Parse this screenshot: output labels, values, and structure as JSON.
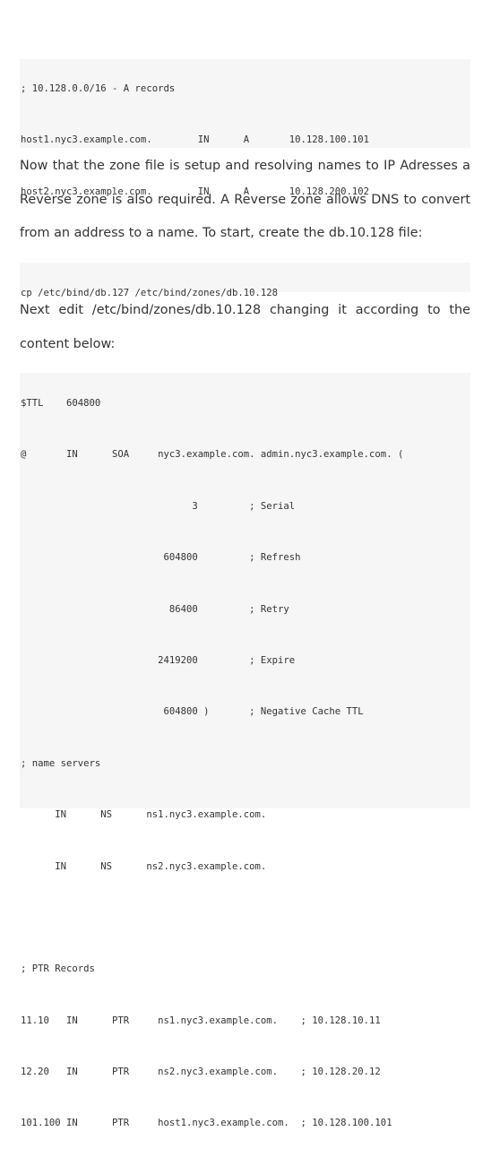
{
  "a_records_block": {
    "lines": [
      "; 10.128.0.0/16 - A records",
      "host1.nyc3.example.com.        IN      A       10.128.100.101",
      "host2.nyc3.example.com.        IN      A       10.128.200.102"
    ]
  },
  "paragraph1": "Now that the zone file is setup and resolving names to IP Adresses a Reverse zone is also required. A Reverse zone allows DNS to convert from an address to a name. To start, create the db.10.128 file:",
  "copy_command_block": {
    "lines": [
      "cp /etc/bind/db.127 /etc/bind/zones/db.10.128"
    ]
  },
  "paragraph2": "Next edit /etc/bind/zones/db.10.128 changing it according to the content below:",
  "reverse_zone_block": {
    "lines": [
      "$TTL    604800",
      "@       IN      SOA     nyc3.example.com. admin.nyc3.example.com. (",
      "                              3         ; Serial",
      "                         604800         ; Refresh",
      "                          86400         ; Retry",
      "                        2419200         ; Expire",
      "                         604800 )       ; Negative Cache TTL",
      "; name servers",
      "      IN      NS      ns1.nyc3.example.com.",
      "      IN      NS      ns2.nyc3.example.com.",
      "",
      "; PTR Records",
      "11.10   IN      PTR     ns1.nyc3.example.com.    ; 10.128.10.11",
      "12.20   IN      PTR     ns2.nyc3.example.com.    ; 10.128.20.12",
      "101.100 IN      PTR     host1.nyc3.example.com.  ; 10.128.100.101"
    ]
  }
}
